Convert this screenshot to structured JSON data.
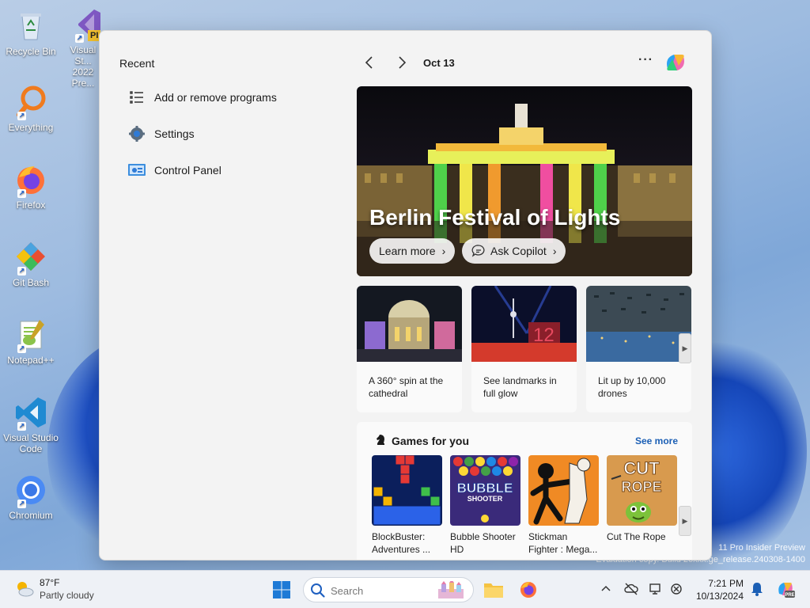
{
  "desktop": {
    "icons": [
      {
        "label": "Recycle Bin",
        "icon": "recycle-bin-icon"
      },
      {
        "label": "Everything",
        "icon": "everything-search-icon"
      },
      {
        "label": "Firefox",
        "icon": "firefox-icon"
      },
      {
        "label": "Git Bash",
        "icon": "git-bash-icon"
      },
      {
        "label": "Notepad++",
        "icon": "notepadpp-icon"
      },
      {
        "label": "Visual Studio Code",
        "icon": "vscode-icon"
      },
      {
        "label": "Chromium",
        "icon": "chromium-icon"
      }
    ],
    "vs_icon_label": "Visual St... 2022 Pre...",
    "vs_badge": "PI",
    "watermark_line1": "11 Pro Insider Preview",
    "watermark_line2": "Evaluation copy. Build 26xxx.ge_release.240308-1400"
  },
  "start_menu": {
    "recent_title": "Recent",
    "recent_items": [
      {
        "label": "Add or remove programs",
        "icon": "list-settings-icon"
      },
      {
        "label": "Settings",
        "icon": "gear-icon"
      },
      {
        "label": "Control Panel",
        "icon": "control-panel-icon"
      }
    ],
    "date": "Oct 13",
    "more": "···",
    "hero": {
      "title": "Berlin Festival of Lights",
      "learn_more": "Learn more",
      "ask_copilot": "Ask Copilot"
    },
    "cards": [
      {
        "caption": "A 360° spin at the cathedral"
      },
      {
        "caption": "See landmarks in full glow"
      },
      {
        "caption": "Lit up by 10,000 drones"
      }
    ],
    "games": {
      "title": "Games for you",
      "see_more": "See more",
      "items": [
        {
          "name": "BlockBuster: Adventures ..."
        },
        {
          "name": "Bubble Shooter HD"
        },
        {
          "name": "Stickman Fighter : Mega..."
        },
        {
          "name": "Cut The Rope"
        }
      ]
    }
  },
  "taskbar": {
    "weather": {
      "temp": "87°F",
      "desc": "Partly cloudy"
    },
    "search_placeholder": "Search",
    "clock": {
      "time": "7:21 PM",
      "date": "10/13/2024"
    }
  },
  "colors": {
    "accent": "#0067c0",
    "see_more": "#1b5fb5",
    "panel_bg": "#f3f3f3"
  }
}
